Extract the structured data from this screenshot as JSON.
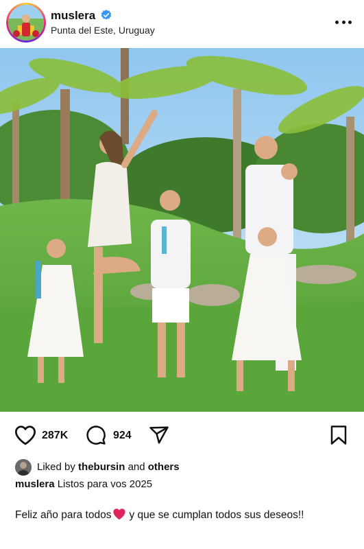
{
  "post": {
    "username": "muslera",
    "location": "Punta del Este, Uruguay",
    "verified": true
  },
  "actions": {
    "likes": "287K",
    "comments": "924"
  },
  "liked_by": {
    "prefix": "Liked by",
    "user": "thebursin",
    "conjunction": "and",
    "others": "others"
  },
  "caption": {
    "username": "muslera",
    "text": "Listos para vos 2025"
  },
  "body": {
    "part1": "Feliz año para todos",
    "emoji": "red-heart",
    "part2": "y que se cumplan todos sus deseos!!"
  },
  "icons": {
    "more": "more-options-icon",
    "like": "heart-icon",
    "comment": "comment-icon",
    "share": "share-icon",
    "save": "bookmark-icon",
    "verified": "verified-badge-icon"
  },
  "colors": {
    "verified": "#3897f0",
    "heart_emoji": "#e0245e"
  }
}
